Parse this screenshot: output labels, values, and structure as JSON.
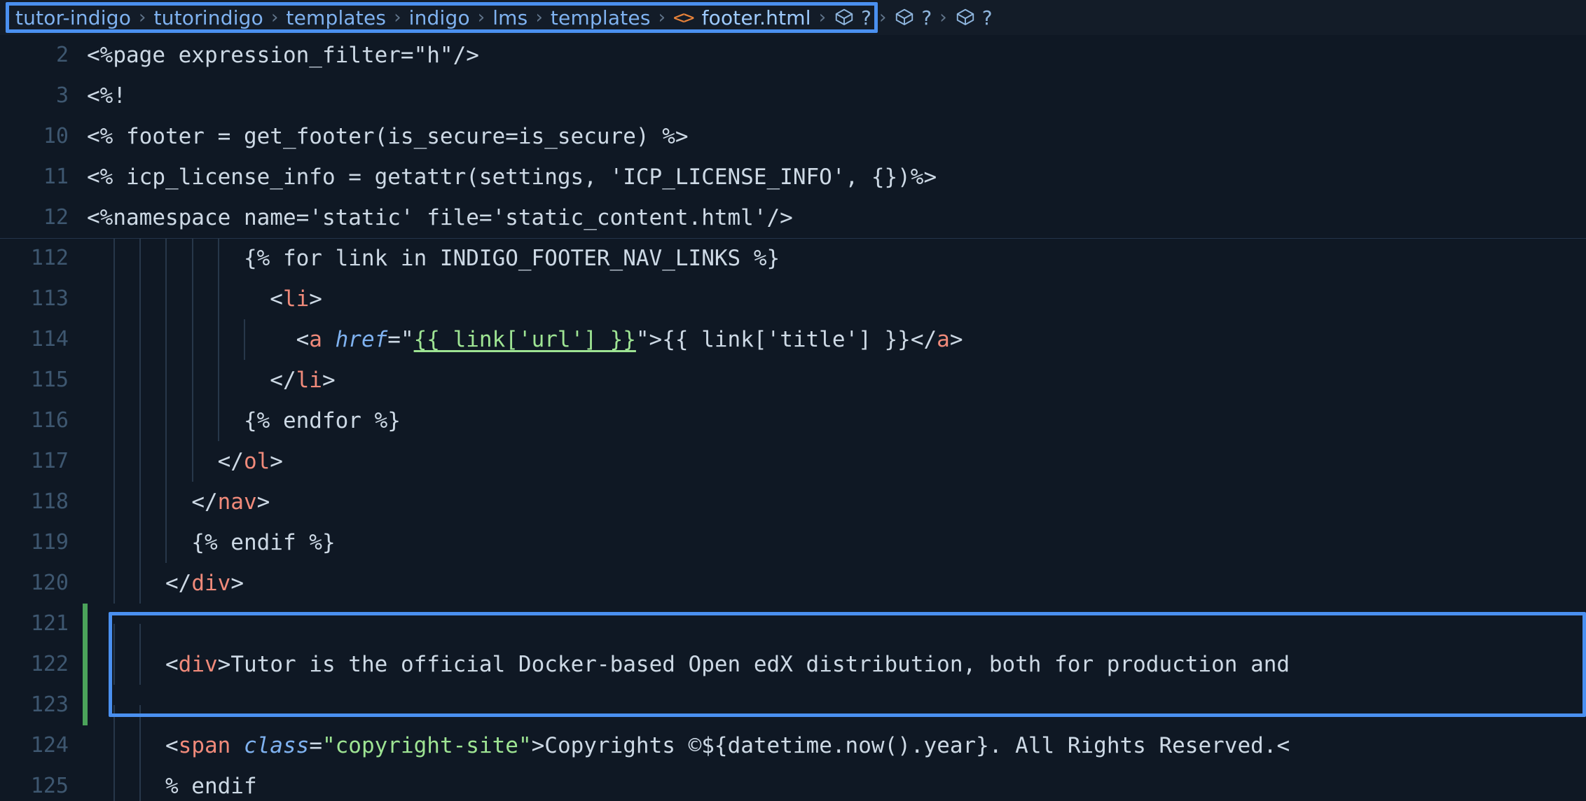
{
  "breadcrumb": {
    "separator": "›",
    "items": [
      {
        "label": "tutor-indigo",
        "type": "folder"
      },
      {
        "label": "tutorindigo",
        "type": "folder"
      },
      {
        "label": "templates",
        "type": "folder"
      },
      {
        "label": "indigo",
        "type": "folder"
      },
      {
        "label": "lms",
        "type": "folder"
      },
      {
        "label": "templates",
        "type": "folder"
      },
      {
        "label": "footer.html",
        "type": "file",
        "icon": "code-icon",
        "icon_glyph": "<>"
      }
    ],
    "symbols": [
      {
        "icon": "cube-icon",
        "label": "?"
      },
      {
        "icon": "cube-icon",
        "label": "?"
      },
      {
        "icon": "cube-icon",
        "label": "?"
      }
    ]
  },
  "editor": {
    "language": "mako-html",
    "colors": {
      "background": "#0f1824",
      "breadcrumb_background": "#131c28",
      "highlight_border": "#4a90f0",
      "line_number": "#3e5770",
      "text": "#cdd9e5",
      "tag": "#f08a7a",
      "attribute": "#7fb2f0",
      "string": "#9ee493",
      "git_modified": "#4ba35a"
    },
    "lines": [
      {
        "number": "2",
        "tokens": [
          {
            "text": "<%page expression_filter=\"h\"/>",
            "kind": "plain"
          }
        ]
      },
      {
        "number": "3",
        "tokens": [
          {
            "text": "<%!",
            "kind": "plain"
          }
        ]
      },
      {
        "number": "10",
        "tokens": [
          {
            "text": "<% footer = get_footer(is_secure=is_secure) %>",
            "kind": "plain"
          }
        ]
      },
      {
        "number": "11",
        "tokens": [
          {
            "text": "<% icp_license_info = getattr(settings, 'ICP_LICENSE_INFO', {})%>",
            "kind": "plain"
          }
        ]
      },
      {
        "number": "12",
        "tokens": [
          {
            "text": "<%namespace name='static' file='static_content.html'/>",
            "kind": "plain"
          }
        ]
      },
      {
        "number": "112",
        "fold_above": true,
        "indent_guides": 5,
        "tokens": [
          {
            "text": "            {% for link in INDIGO_FOOTER_NAV_LINKS %}",
            "kind": "plain"
          }
        ]
      },
      {
        "number": "113",
        "indent_guides": 5,
        "tokens": [
          {
            "text": "              ",
            "kind": "plain"
          },
          {
            "text": "<",
            "kind": "punct"
          },
          {
            "text": "li",
            "kind": "tag"
          },
          {
            "text": ">",
            "kind": "punct"
          }
        ]
      },
      {
        "number": "114",
        "indent_guides": 6,
        "tokens": [
          {
            "text": "                ",
            "kind": "plain"
          },
          {
            "text": "<",
            "kind": "punct"
          },
          {
            "text": "a ",
            "kind": "tag"
          },
          {
            "text": "href",
            "kind": "attr"
          },
          {
            "text": "=\"",
            "kind": "punct"
          },
          {
            "text": "{{ link['url'] }}",
            "kind": "link"
          },
          {
            "text": "\">",
            "kind": "punct"
          },
          {
            "text": "{{ link['title'] }}",
            "kind": "plain"
          },
          {
            "text": "</",
            "kind": "punct"
          },
          {
            "text": "a",
            "kind": "tag"
          },
          {
            "text": ">",
            "kind": "punct"
          }
        ]
      },
      {
        "number": "115",
        "indent_guides": 5,
        "tokens": [
          {
            "text": "              ",
            "kind": "plain"
          },
          {
            "text": "</",
            "kind": "punct"
          },
          {
            "text": "li",
            "kind": "tag"
          },
          {
            "text": ">",
            "kind": "punct"
          }
        ]
      },
      {
        "number": "116",
        "indent_guides": 5,
        "tokens": [
          {
            "text": "            {% endfor %}",
            "kind": "plain"
          }
        ]
      },
      {
        "number": "117",
        "indent_guides": 4,
        "tokens": [
          {
            "text": "          ",
            "kind": "plain"
          },
          {
            "text": "</",
            "kind": "punct"
          },
          {
            "text": "ol",
            "kind": "tag"
          },
          {
            "text": ">",
            "kind": "punct"
          }
        ]
      },
      {
        "number": "118",
        "indent_guides": 3,
        "tokens": [
          {
            "text": "        ",
            "kind": "plain"
          },
          {
            "text": "</",
            "kind": "punct"
          },
          {
            "text": "nav",
            "kind": "tag"
          },
          {
            "text": ">",
            "kind": "punct"
          }
        ]
      },
      {
        "number": "119",
        "indent_guides": 3,
        "tokens": [
          {
            "text": "        {% endif %}",
            "kind": "plain"
          }
        ]
      },
      {
        "number": "120",
        "indent_guides": 2,
        "tokens": [
          {
            "text": "      ",
            "kind": "plain"
          },
          {
            "text": "</",
            "kind": "punct"
          },
          {
            "text": "div",
            "kind": "tag"
          },
          {
            "text": ">",
            "kind": "punct"
          }
        ]
      },
      {
        "number": "121",
        "git_modified": true,
        "indent_guides": 2,
        "tokens": [
          {
            "text": "",
            "kind": "plain"
          }
        ]
      },
      {
        "number": "122",
        "git_modified": true,
        "indent_guides": 2,
        "tokens": [
          {
            "text": "      ",
            "kind": "plain"
          },
          {
            "text": "<",
            "kind": "punct"
          },
          {
            "text": "div",
            "kind": "tag"
          },
          {
            "text": ">",
            "kind": "punct"
          },
          {
            "text": "Tutor is the official Docker-based Open edX distribution, both for production and",
            "kind": "plain"
          }
        ]
      },
      {
        "number": "123",
        "git_modified": true,
        "indent_guides": 2,
        "tokens": [
          {
            "text": "",
            "kind": "plain"
          }
        ]
      },
      {
        "number": "124",
        "indent_guides": 2,
        "tokens": [
          {
            "text": "      ",
            "kind": "plain"
          },
          {
            "text": "<",
            "kind": "punct"
          },
          {
            "text": "span ",
            "kind": "tag"
          },
          {
            "text": "class",
            "kind": "attr"
          },
          {
            "text": "=",
            "kind": "punct"
          },
          {
            "text": "\"copyright-site\"",
            "kind": "str"
          },
          {
            "text": ">",
            "kind": "punct"
          },
          {
            "text": "Copyrights ©${datetime.now().year}. All Rights Reserved.<",
            "kind": "plain"
          }
        ]
      },
      {
        "number": "125",
        "indent_guides": 2,
        "tokens": [
          {
            "text": "      % endif",
            "kind": "plain"
          }
        ]
      }
    ]
  }
}
